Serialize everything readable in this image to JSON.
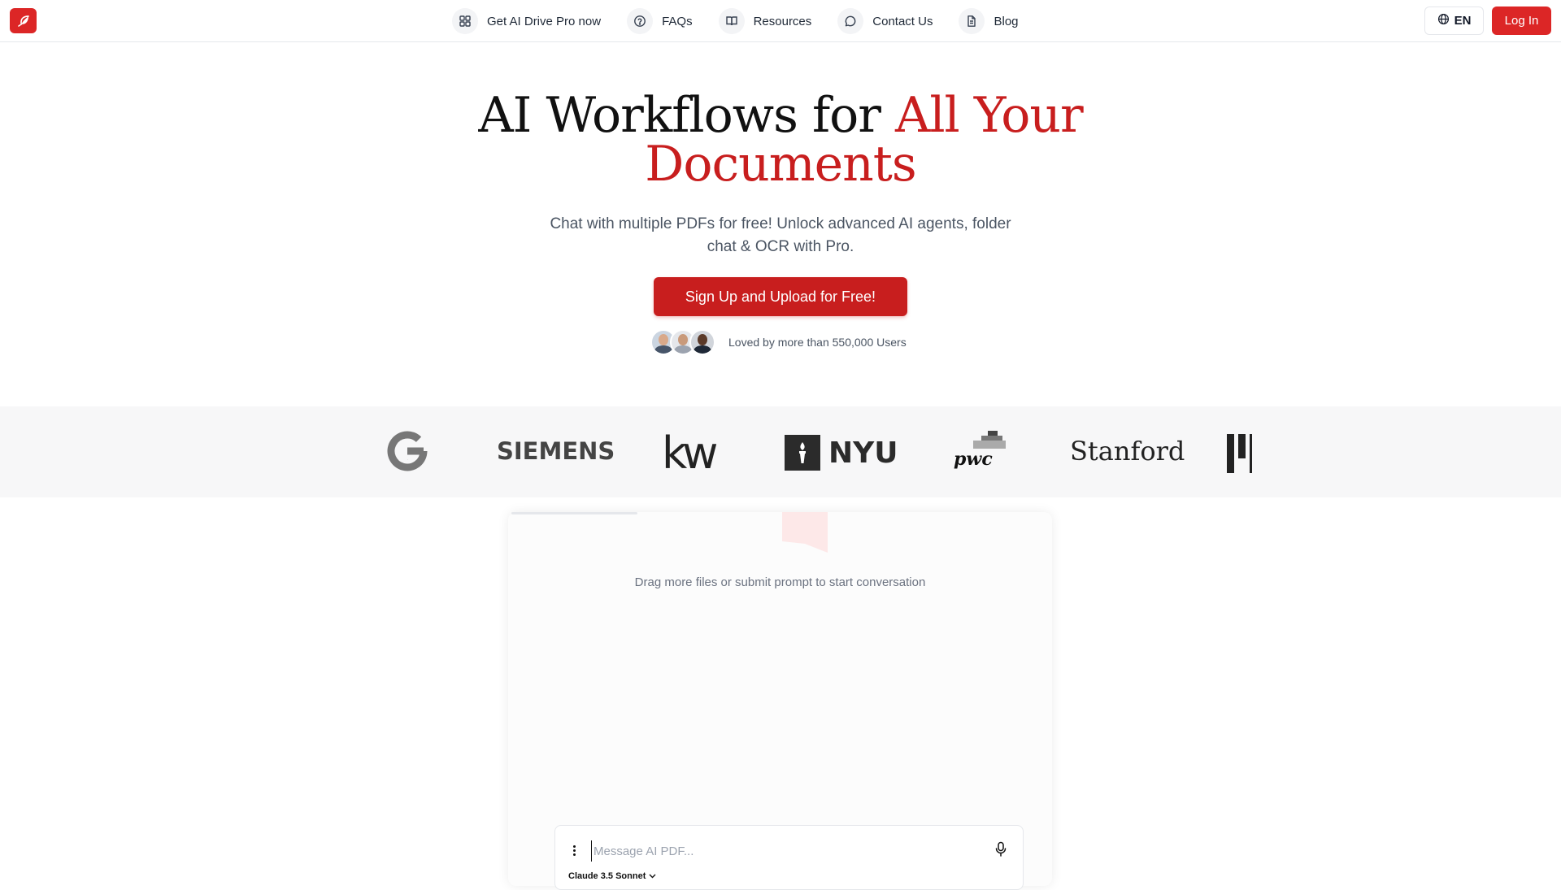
{
  "header": {
    "logo_icon": "leaf-logo-icon",
    "nav": [
      {
        "label": "Get AI Drive Pro now",
        "icon": "grid-icon"
      },
      {
        "label": "FAQs",
        "icon": "question-circle-icon"
      },
      {
        "label": "Resources",
        "icon": "book-open-icon"
      },
      {
        "label": "Contact Us",
        "icon": "chat-bubble-icon"
      },
      {
        "label": "Blog",
        "icon": "document-icon"
      }
    ],
    "language": "EN",
    "login_label": "Log In"
  },
  "hero": {
    "title_plain": "AI Workflows for ",
    "title_accent_1": "All Your",
    "title_accent_2": "Documents",
    "subtitle": "Chat with multiple PDFs for free! Unlock advanced AI agents, folder chat & OCR with Pro.",
    "cta_label": "Sign Up and Upload for Free!",
    "social_proof": "Loved by more than 550,000 Users"
  },
  "logos": {
    "items": [
      "G",
      "SIEMENS",
      "kw",
      "NYU",
      "pwc",
      "Stanford"
    ]
  },
  "chat": {
    "empty_state": "Drag more files or submit prompt to start conversation",
    "input_placeholder": "Message AI PDF...",
    "model_label": "Claude 3.5 Sonnet"
  },
  "colors": {
    "accent": "#c81e1e",
    "brand_red": "#dc2626",
    "strip_bg": "#f7f7f8"
  }
}
